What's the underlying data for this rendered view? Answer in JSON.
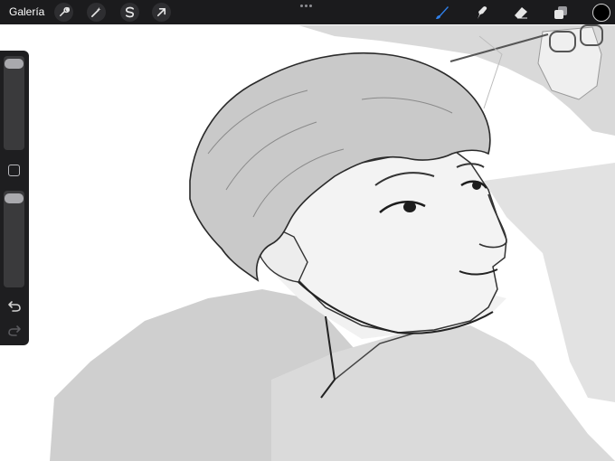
{
  "toolbar": {
    "gallery_label": "Galería",
    "left_tools": [
      {
        "name": "actions",
        "icon": "wrench-icon"
      },
      {
        "name": "adjustments",
        "icon": "magic-wand-icon"
      },
      {
        "name": "selection",
        "icon": "selection-s-icon"
      },
      {
        "name": "transform",
        "icon": "transform-arrow-icon"
      }
    ],
    "more_icon": "more-dots-icon",
    "right_tools": [
      {
        "name": "brush",
        "icon": "brush-icon",
        "active": true
      },
      {
        "name": "smudge",
        "icon": "smudge-icon",
        "active": false
      },
      {
        "name": "eraser",
        "icon": "eraser-icon",
        "active": false
      },
      {
        "name": "layers",
        "icon": "layers-icon",
        "active": false
      }
    ],
    "current_color": "#000000"
  },
  "sidebar": {
    "size_slider_icon": "brush-size-slider",
    "modifier_icon": "modifier-square-icon",
    "opacity_slider_icon": "opacity-slider",
    "undo_icon": "undo-arrow-icon",
    "redo_icon": "redo-arrow-icon"
  },
  "colors": {
    "toolbar_bg": "#1b1b1d",
    "active_tool": "#2f7fe8",
    "inactive_tool": "#e6e6e6"
  }
}
